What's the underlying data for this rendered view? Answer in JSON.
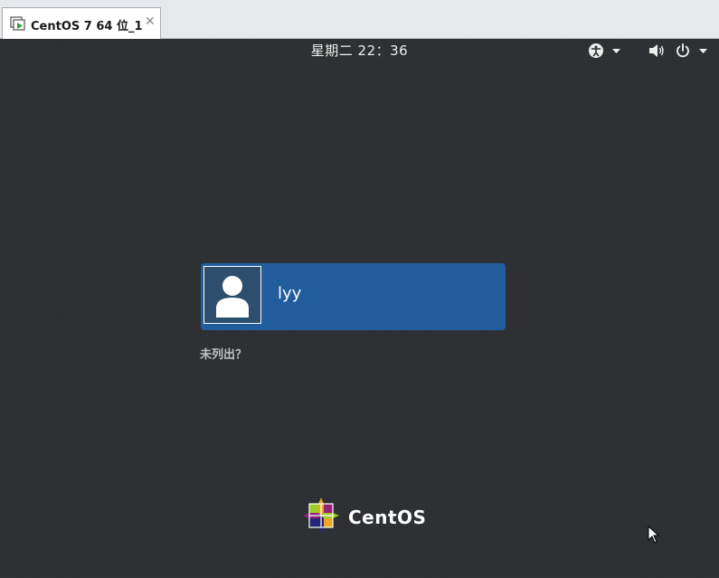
{
  "vm_tab": {
    "label": "CentOS 7 64 位_1",
    "close": "✕"
  },
  "topbar": {
    "clock": "星期二 22：36"
  },
  "icons": [
    "accessibility-icon",
    "chevron-down-icon",
    "volume-icon",
    "power-icon"
  ],
  "login": {
    "user": {
      "name": "lyy"
    },
    "not_listed": "未列出？"
  },
  "branding": {
    "logo_text": "CentOS"
  },
  "colors": {
    "screen_bg": "#2c2f31",
    "selected_user": "#215d9c"
  }
}
